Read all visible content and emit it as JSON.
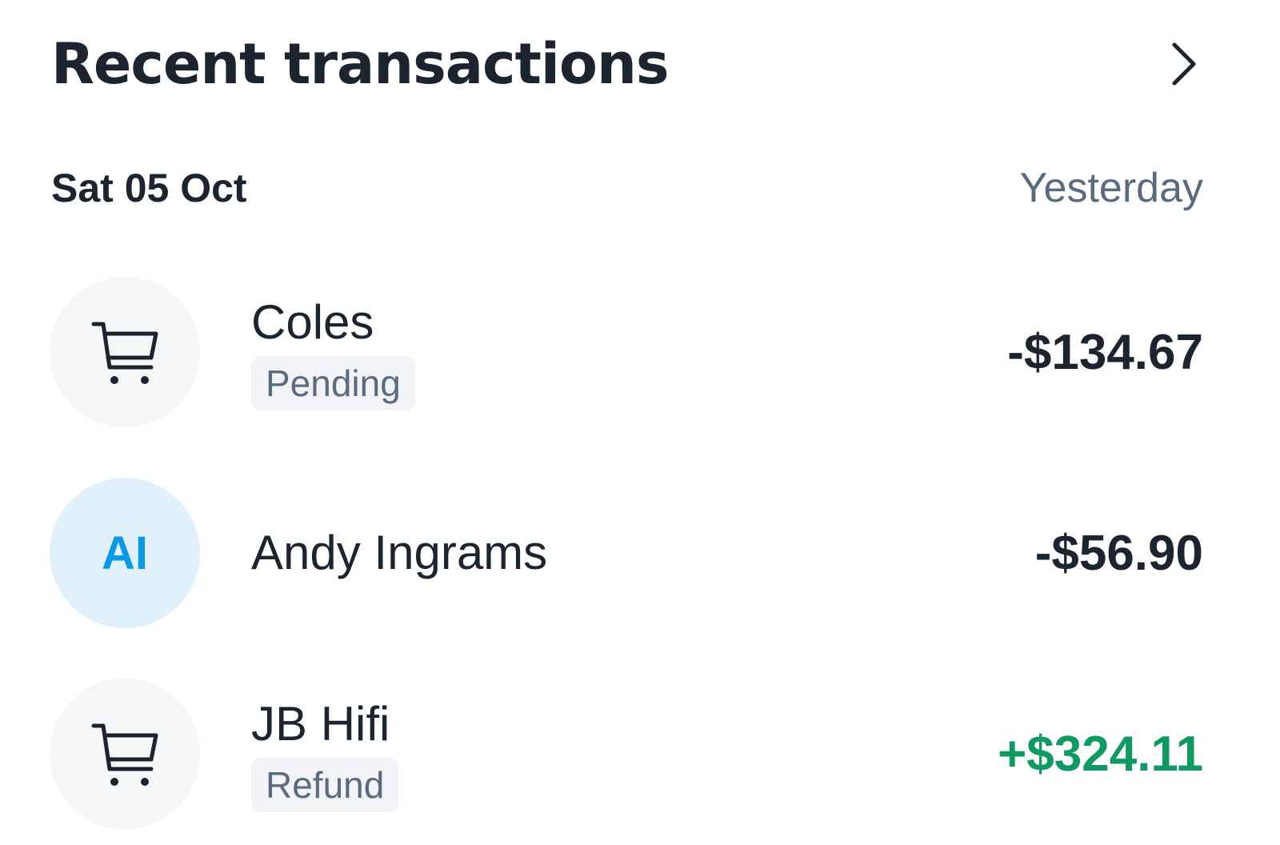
{
  "header": {
    "title": "Recent transactions",
    "chevron_icon": "chevron-right-icon"
  },
  "group": {
    "date": "Sat 05 Oct",
    "relative": "Yesterday"
  },
  "transactions": [
    {
      "name": "Coles",
      "status": "Pending",
      "amount": "-$134.67",
      "icon": "shopping-cart-icon"
    },
    {
      "name": "Andy Ingrams",
      "initials": "AI",
      "amount": "-$56.90"
    },
    {
      "name": "JB Hifi",
      "status": "Refund",
      "amount": "+$324.11",
      "icon": "shopping-cart-icon"
    }
  ],
  "colors": {
    "text": "#1c2430",
    "muted": "#5a6b80",
    "credit": "#0f9a62",
    "initials_accent": "#0a98e8"
  }
}
